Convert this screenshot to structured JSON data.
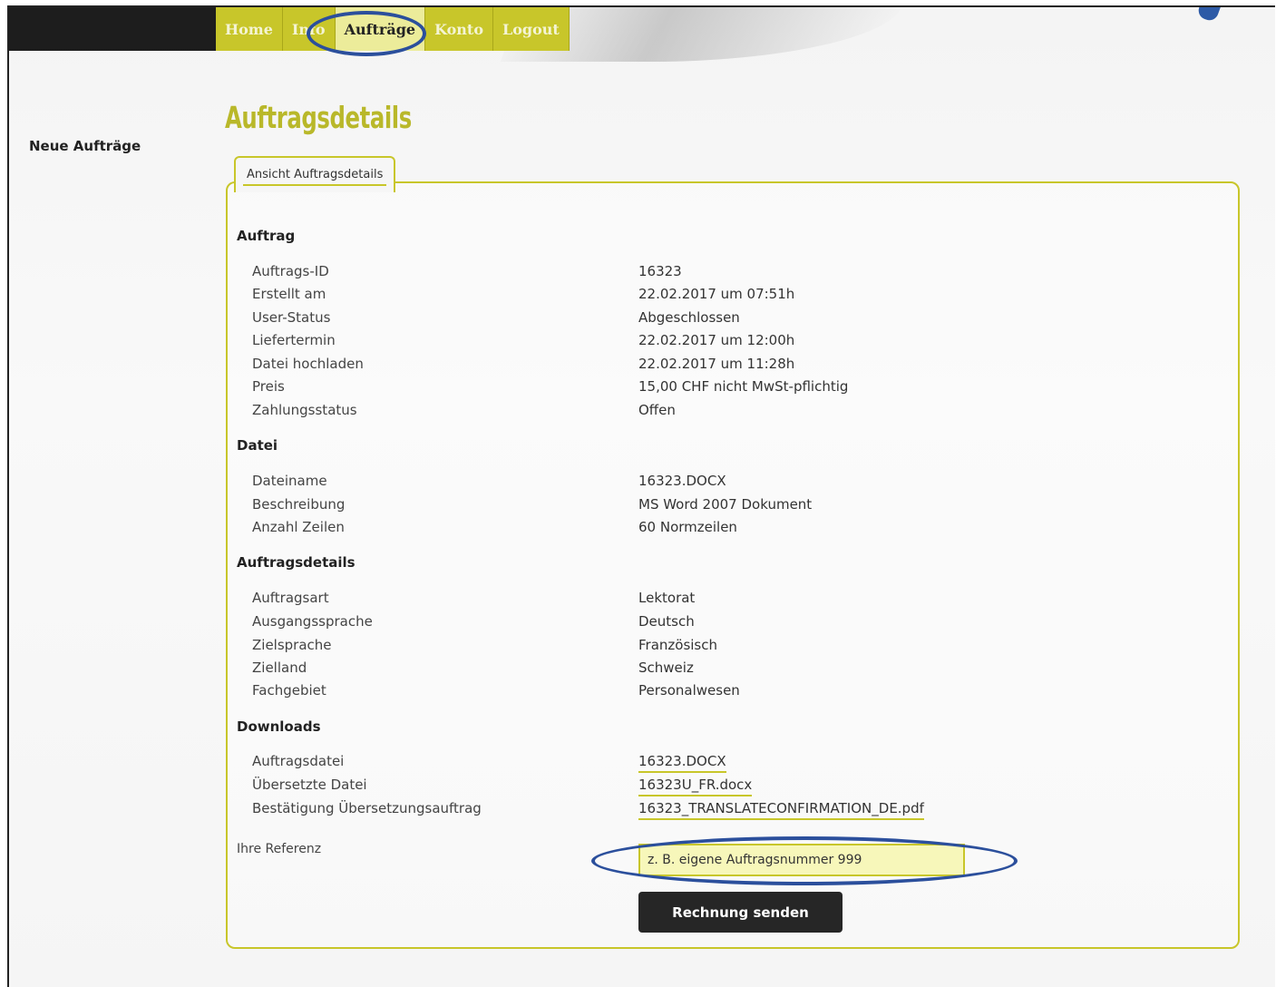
{
  "nav": {
    "items": [
      {
        "label": "Home"
      },
      {
        "label": "Info"
      },
      {
        "label": "Aufträge"
      },
      {
        "label": "Konto"
      },
      {
        "label": "Logout"
      }
    ],
    "active": "Aufträge"
  },
  "sidebar": {
    "new_orders": "Neue Aufträge"
  },
  "page_title": "Auftragsdetails",
  "panel_tab": "Ansicht Auftragsdetails",
  "sections": {
    "auftrag": {
      "title": "Auftrag",
      "rows": [
        {
          "label": "Auftrags-ID",
          "value": "16323"
        },
        {
          "label": "Erstellt am",
          "value": "22.02.2017 um 07:51h"
        },
        {
          "label": "User-Status",
          "value": "Abgeschlossen"
        },
        {
          "label": "Liefertermin",
          "value": "22.02.2017 um 12:00h"
        },
        {
          "label": "Datei hochladen",
          "value": "22.02.2017 um 11:28h"
        },
        {
          "label": "Preis",
          "value": "15,00 CHF nicht MwSt-pflichtig"
        },
        {
          "label": "Zahlungsstatus",
          "value": "Offen"
        }
      ]
    },
    "datei": {
      "title": "Datei",
      "rows": [
        {
          "label": "Dateiname",
          "value": "16323.DOCX"
        },
        {
          "label": "Beschreibung",
          "value": "MS Word 2007 Dokument"
        },
        {
          "label": "Anzahl Zeilen",
          "value": "60 Normzeilen"
        }
      ]
    },
    "details": {
      "title": "Auftragsdetails",
      "rows": [
        {
          "label": "Auftragsart",
          "value": "Lektorat"
        },
        {
          "label": "Ausgangssprache",
          "value": "Deutsch"
        },
        {
          "label": "Zielsprache",
          "value": "Französisch"
        },
        {
          "label": "Zielland",
          "value": "Schweiz"
        },
        {
          "label": "Fachgebiet",
          "value": "Personalwesen"
        }
      ]
    },
    "downloads": {
      "title": "Downloads",
      "rows": [
        {
          "label": "Auftragsdatei",
          "value": "16323.DOCX"
        },
        {
          "label": "Übersetzte Datei",
          "value": "16323U_FR.docx"
        },
        {
          "label": "Bestätigung Übersetzungsauftrag",
          "value": "16323_TRANSLATECONFIRMATION_DE.pdf"
        }
      ]
    }
  },
  "reference": {
    "label": "Ihre Referenz",
    "placeholder": "z. B. eigene Auftragsnummer 999"
  },
  "send_button": "Rechnung senden",
  "colors": {
    "accent": "#c8c62a",
    "title": "#b9b82a",
    "highlight_ellipse": "#2b4f9c",
    "button": "#262626"
  }
}
